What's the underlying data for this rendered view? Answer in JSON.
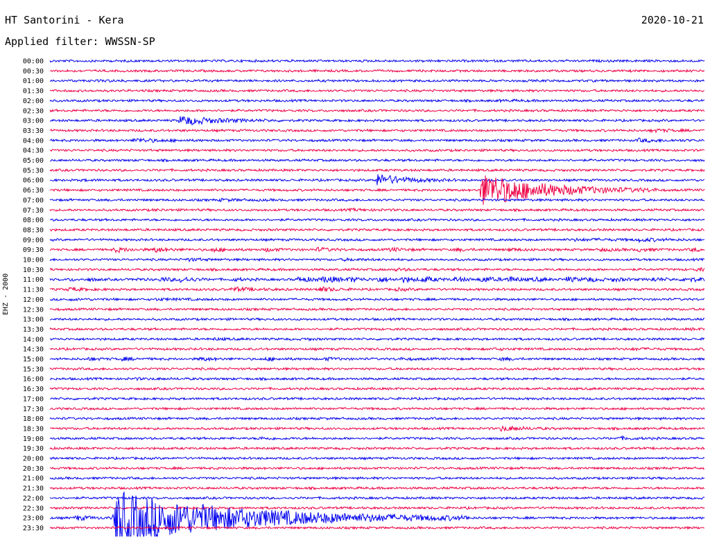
{
  "header": {
    "station": "HT Santorini - Kera",
    "date": "2020-10-21",
    "filter": "Applied filter: WWSSN-SP"
  },
  "chart_data": {
    "type": "line",
    "title": "HT Santorini - Kera",
    "subtitle": "Applied filter: WWSSN-SP",
    "date": "2020-10-21",
    "ylabel": "EHZ - 2000",
    "xlabel": "",
    "colors": {
      "even": "#0000ee",
      "odd": "#ee0044"
    },
    "rows": [
      {
        "label": "00:00",
        "events": []
      },
      {
        "label": "00:30",
        "events": []
      },
      {
        "label": "01:00",
        "events": [
          [
            0.08,
            0.2,
            0.02
          ]
        ]
      },
      {
        "label": "01:30",
        "events": []
      },
      {
        "label": "02:00",
        "events": [
          [
            0.69,
            0.25,
            0.02
          ]
        ]
      },
      {
        "label": "02:30",
        "events": []
      },
      {
        "label": "03:00",
        "events": [
          [
            0.2,
            2.0,
            0.05
          ]
        ]
      },
      {
        "label": "03:30",
        "events": [
          [
            0.92,
            0.5,
            0.03
          ]
        ]
      },
      {
        "label": "04:00",
        "events": [
          [
            0.13,
            0.7,
            0.04
          ],
          [
            0.9,
            0.6,
            0.04
          ]
        ]
      },
      {
        "label": "04:30",
        "events": []
      },
      {
        "label": "05:00",
        "events": []
      },
      {
        "label": "05:30",
        "events": []
      },
      {
        "label": "06:00",
        "events": [
          [
            0.05,
            0.2,
            0.02
          ],
          [
            0.5,
            2.5,
            0.04
          ]
        ]
      },
      {
        "label": "06:30",
        "events": [
          [
            0.66,
            7.5,
            0.09
          ]
        ]
      },
      {
        "label": "07:00",
        "events": [
          [
            0.26,
            0.3,
            0.04
          ]
        ]
      },
      {
        "label": "07:30",
        "events": [
          [
            0.46,
            0.3,
            0.03
          ],
          [
            0.16,
            0.2,
            0.02
          ]
        ]
      },
      {
        "label": "08:00",
        "events": []
      },
      {
        "label": "08:30",
        "events": []
      },
      {
        "label": "09:00",
        "events": [
          [
            0.8,
            0.3,
            0.08
          ],
          [
            0.9,
            0.5,
            0.03
          ]
        ]
      },
      {
        "label": "09:30",
        "events": [
          [
            0.1,
            0.9,
            0.02
          ],
          [
            0.16,
            1.0,
            0.02
          ],
          [
            0.25,
            0.7,
            0.02
          ],
          [
            0.33,
            0.6,
            0.02
          ],
          [
            0.41,
            0.7,
            0.02
          ],
          [
            0.52,
            0.6,
            0.02
          ],
          [
            0.62,
            0.5,
            0.02
          ],
          [
            0.7,
            0.5,
            0.02
          ],
          [
            0.84,
            0.6,
            0.02
          ],
          [
            0.9,
            0.6,
            0.02
          ],
          [
            0.98,
            0.5,
            0.02
          ]
        ]
      },
      {
        "label": "10:00",
        "events": [
          [
            0.21,
            0.5,
            0.02
          ],
          [
            0.45,
            0.3,
            0.03
          ]
        ]
      },
      {
        "label": "10:30",
        "events": [
          [
            0.53,
            0.4,
            0.02
          ],
          [
            0.99,
            0.5,
            0.02
          ]
        ]
      },
      {
        "label": "11:00",
        "events": [
          [
            0.03,
            0.5,
            0.01
          ],
          [
            0.06,
            0.6,
            0.01
          ],
          [
            0.13,
            0.5,
            0.01
          ],
          [
            0.17,
            0.8,
            0.02
          ],
          [
            0.2,
            1.0,
            0.02
          ],
          [
            0.28,
            0.5,
            0.02
          ],
          [
            0.38,
            0.9,
            0.03
          ],
          [
            0.42,
            1.2,
            0.02
          ],
          [
            0.46,
            0.8,
            0.02
          ],
          [
            0.5,
            1.1,
            0.02
          ],
          [
            0.54,
            0.9,
            0.02
          ],
          [
            0.57,
            1.0,
            0.02
          ],
          [
            0.62,
            0.8,
            0.02
          ],
          [
            0.66,
            1.1,
            0.02
          ],
          [
            0.7,
            1.0,
            0.02
          ],
          [
            0.74,
            0.6,
            0.02
          ],
          [
            0.79,
            0.9,
            0.02
          ],
          [
            0.82,
            0.7,
            0.02
          ],
          [
            0.86,
            0.6,
            0.02
          ],
          [
            0.92,
            0.7,
            0.02
          ],
          [
            0.97,
            0.8,
            0.03
          ]
        ]
      },
      {
        "label": "11:30",
        "events": [
          [
            0.03,
            0.6,
            0.02
          ],
          [
            0.28,
            0.8,
            0.03
          ],
          [
            0.41,
            1.1,
            0.02
          ],
          [
            0.53,
            0.4,
            0.02
          ]
        ]
      },
      {
        "label": "12:00",
        "events": [
          [
            0.16,
            0.3,
            0.04
          ],
          [
            0.03,
            0.2,
            0.03
          ]
        ]
      },
      {
        "label": "12:30",
        "events": []
      },
      {
        "label": "13:00",
        "events": []
      },
      {
        "label": "13:30",
        "events": [
          [
            0.98,
            0.2,
            0.02
          ]
        ]
      },
      {
        "label": "14:00",
        "events": [
          [
            0.25,
            0.3,
            0.02
          ],
          [
            0.39,
            0.3,
            0.01
          ]
        ]
      },
      {
        "label": "14:30",
        "events": [
          [
            0.68,
            0.3,
            0.02
          ],
          [
            0.89,
            0.4,
            0.02
          ]
        ]
      },
      {
        "label": "15:00",
        "events": [
          [
            0.06,
            0.4,
            0.02
          ],
          [
            0.11,
            0.5,
            0.02
          ],
          [
            0.23,
            0.6,
            0.02
          ],
          [
            0.33,
            0.6,
            0.02
          ],
          [
            0.42,
            0.5,
            0.02
          ],
          [
            0.53,
            0.4,
            0.02
          ],
          [
            0.69,
            0.4,
            0.02
          ]
        ]
      },
      {
        "label": "15:30",
        "events": []
      },
      {
        "label": "16:00",
        "events": [
          [
            0.13,
            0.2,
            0.05
          ]
        ]
      },
      {
        "label": "16:30",
        "events": []
      },
      {
        "label": "17:00",
        "events": []
      },
      {
        "label": "17:30",
        "events": []
      },
      {
        "label": "18:00",
        "events": []
      },
      {
        "label": "18:30",
        "events": [
          [
            0.69,
            1.0,
            0.03
          ]
        ]
      },
      {
        "label": "19:00",
        "events": [
          [
            0.32,
            0.4,
            0.02
          ],
          [
            0.87,
            0.5,
            0.02
          ]
        ]
      },
      {
        "label": "19:30",
        "events": []
      },
      {
        "label": "20:00",
        "events": []
      },
      {
        "label": "20:30",
        "events": []
      },
      {
        "label": "21:00",
        "events": []
      },
      {
        "label": "21:30",
        "events": []
      },
      {
        "label": "22:00",
        "events": []
      },
      {
        "label": "22:30",
        "events": []
      },
      {
        "label": "23:00",
        "events": [
          [
            0.04,
            1.0,
            0.02
          ],
          [
            0.1,
            12.0,
            0.18
          ]
        ]
      },
      {
        "label": "23:30",
        "events": []
      }
    ]
  }
}
